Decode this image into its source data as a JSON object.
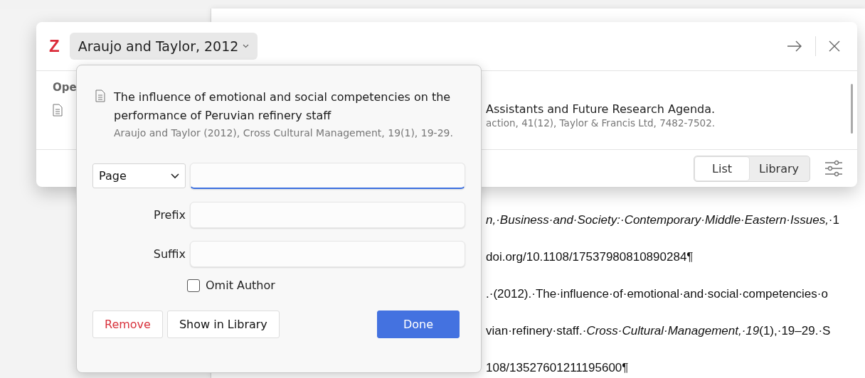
{
  "document_lines": [
    {
      "text": "*n,·Business·and·Society:·Contemporary·Middle·Eastern·Issues,*·1"
    },
    {
      "text": "doi.org/10.1108/17537980810890284¶"
    },
    {
      "text": ".·(2012).·The·influence·of·emotional·and·social·competencies·o"
    },
    {
      "text": "vian·refinery·staff.·*Cross·Cultural·Management,·19*(1),·19–29.·S"
    },
    {
      "text": "108/13527601211195600¶"
    }
  ],
  "dialog": {
    "logo": "Z",
    "citation_button": "Araujo and Taylor, 2012",
    "section_label": "Ope",
    "items": [
      {
        "title": "Assistants and Future Research Agenda.",
        "meta": "action, 41(12), Taylor & Francis Ltd, 7482-7502."
      }
    ],
    "view_toggle": [
      {
        "label": "List",
        "selected": true
      },
      {
        "label": "Library",
        "selected": false
      }
    ]
  },
  "popup": {
    "title": "The influence of emotional and social competencies on the performance of Peruvian refinery staff",
    "meta": "Araujo and Taylor (2012), Cross Cultural Management, 19(1), 19-29.",
    "locator": {
      "label": "Page",
      "focused": true
    },
    "fields": [
      {
        "label": "Prefix"
      },
      {
        "label": "Suffix"
      }
    ],
    "checkbox": {
      "label": "Omit Author",
      "checked": false
    },
    "buttons": [
      {
        "label": "Remove",
        "kind": "danger"
      },
      {
        "label": "Show in Library",
        "kind": "normal"
      },
      {
        "label": "Done",
        "kind": "primary"
      }
    ]
  }
}
